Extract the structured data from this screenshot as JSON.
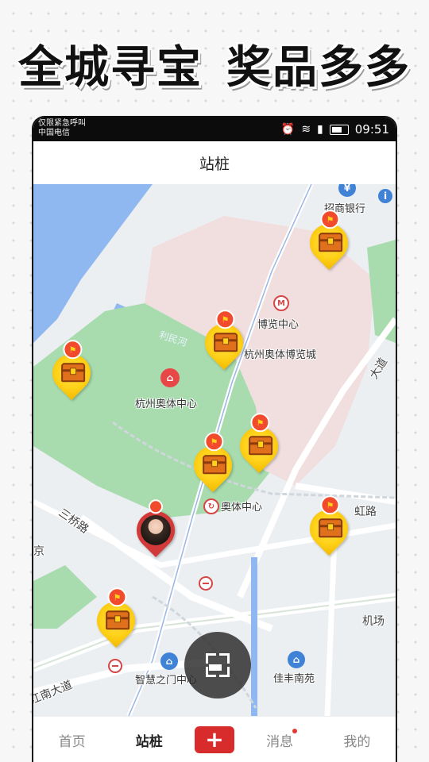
{
  "headline": {
    "left": "全城寻宝",
    "right": "奖品多多"
  },
  "status_bar": {
    "carrier_line1": "仅限紧急呼叫",
    "carrier_line2": "中国电信",
    "time": "09:51"
  },
  "nav": {
    "title": "站桩"
  },
  "map": {
    "labels": {
      "bank": "招商银行",
      "expo_center": "博览中心",
      "expo_city": "杭州奥体博览城",
      "sports_center": "杭州奥体中心",
      "river": "利民河",
      "olympic_center": "奥体中心",
      "rainbow_road": "虹路",
      "sanqiao_road": "三桥路",
      "airport": "机场",
      "wisdom_gate": "智慧之门中心",
      "jiafeng": "佳丰南苑",
      "jiangnan_ave": "江南大道",
      "avenue_right": "大道",
      "road_prefix": "京"
    }
  },
  "tabs": [
    {
      "label": "首页",
      "active": false
    },
    {
      "label": "站桩",
      "active": true
    },
    {
      "label": "+",
      "active": false
    },
    {
      "label": "消息",
      "active": false,
      "has_dot": true
    },
    {
      "label": "我的",
      "active": false
    }
  ],
  "colors": {
    "accent": "#d82c2c",
    "water": "#8fb8f0",
    "park": "#a8dcae",
    "venue": "#f1dede",
    "road": "#ffffff"
  }
}
